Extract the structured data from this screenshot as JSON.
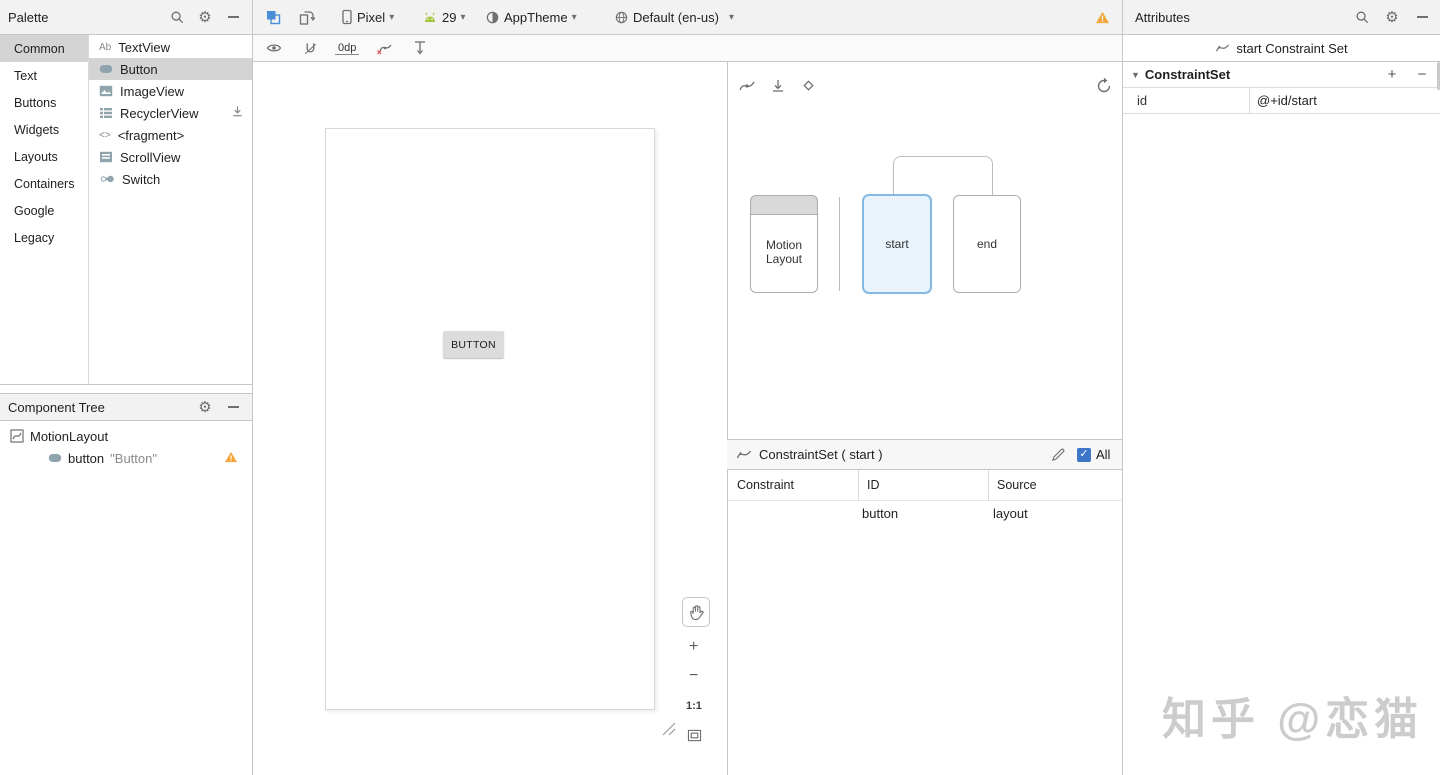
{
  "glyphs": {
    "gear": "⚙",
    "chevron_down": "▾",
    "check": "✓",
    "plus": "+",
    "minus": "−",
    "section_arrow": "▼",
    "ratio": "1:1",
    "textview_icon": "Ab",
    "fragment_icon": "<>"
  },
  "topbar": {
    "palette_title": "Palette",
    "attributes_title": "Attributes",
    "device": "Pixel",
    "api_level": "29",
    "theme": "AppTheme",
    "locale": "Default (en-us)"
  },
  "canvas_toolbar": {
    "margin": "0dp"
  },
  "palette": {
    "categories": [
      {
        "label": "Common",
        "selected": true
      },
      {
        "label": "Text",
        "selected": false
      },
      {
        "label": "Buttons",
        "selected": false
      },
      {
        "label": "Widgets",
        "selected": false
      },
      {
        "label": "Layouts",
        "selected": false
      },
      {
        "label": "Containers",
        "selected": false
      },
      {
        "label": "Google",
        "selected": false
      },
      {
        "label": "Legacy",
        "selected": false
      }
    ],
    "items": [
      {
        "label": "TextView"
      },
      {
        "label": "Button",
        "selected": true
      },
      {
        "label": "ImageView"
      },
      {
        "label": "RecyclerView",
        "downloadable": true
      },
      {
        "label": "<fragment>"
      },
      {
        "label": "ScrollView"
      },
      {
        "label": "Switch"
      }
    ]
  },
  "component_tree": {
    "title": "Component Tree",
    "items": [
      {
        "label": "MotionLayout"
      },
      {
        "label": "button",
        "detail": "\"Button\"",
        "warning": true
      }
    ]
  },
  "canvas": {
    "button_label": "BUTTON"
  },
  "motion": {
    "states": {
      "motionlayout": "Motion Layout",
      "start": "start",
      "end": "end"
    },
    "panel": {
      "title": "ConstraintSet ( start )",
      "all_label": "All",
      "columns": [
        "Constraint",
        "ID",
        "Source"
      ],
      "rows": [
        {
          "id": "button",
          "source": "layout"
        }
      ]
    }
  },
  "attributes": {
    "subtitle": "start Constraint Set",
    "section_title": "ConstraintSet",
    "rows": [
      {
        "key": "id",
        "value": "@+id/start"
      }
    ]
  },
  "watermark": "知乎 @恋猫"
}
